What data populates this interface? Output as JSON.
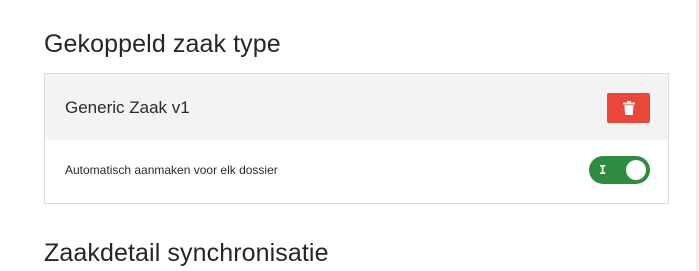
{
  "sections": {
    "linked_case_type_heading": "Gekoppeld zaak type",
    "case_detail_sync_heading": "Zaakdetail synchronisatie"
  },
  "linked_case": {
    "name": "Generic Zaak v1",
    "delete_icon": "trash-icon",
    "delete_color": "#e8473a",
    "auto_create": {
      "label": "Automatisch aanmaken voor elk dossier",
      "toggle_state_text": "I",
      "enabled": true,
      "toggle_color": "#2e8b3f"
    }
  }
}
